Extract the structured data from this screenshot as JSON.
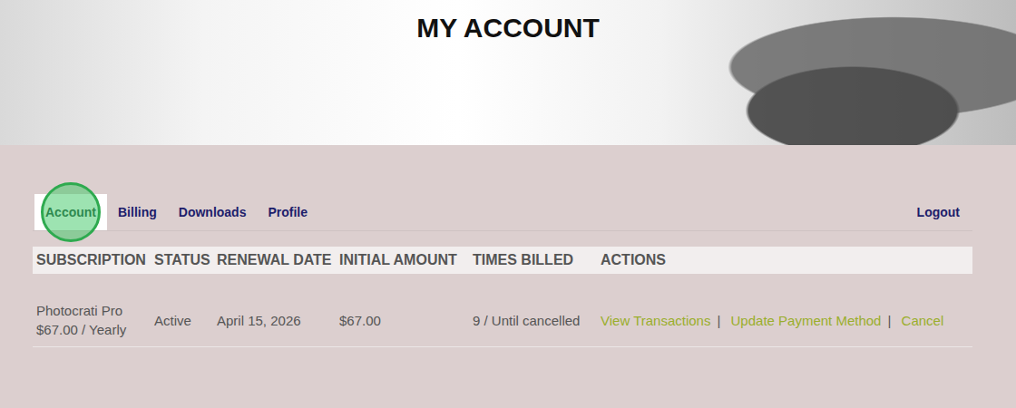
{
  "header": {
    "title": "MY ACCOUNT"
  },
  "tabs": [
    {
      "label": "Account",
      "selected": true,
      "marked": true
    },
    {
      "label": "Billing",
      "selected": false,
      "marked": false
    },
    {
      "label": "Downloads",
      "selected": false,
      "marked": false
    },
    {
      "label": "Profile",
      "selected": false,
      "marked": false
    }
  ],
  "logout": "Logout",
  "table": {
    "columns": [
      "SUBSCRIPTION",
      "STATUS",
      "RENEWAL DATE",
      "INITIAL AMOUNT",
      "TIMES BILLED",
      "ACTIONS"
    ],
    "rows": [
      {
        "subscription": {
          "name": "Photocrati Pro",
          "price": "$67.00 / Yearly"
        },
        "status": "Active",
        "renewal_date": "April 15, 2026",
        "initial_amount": "$67.00",
        "times_billed": "9 / Until cancelled",
        "actions": [
          "View Transactions",
          "Update Payment Method",
          "Cancel"
        ]
      }
    ]
  },
  "action_separator": "|"
}
